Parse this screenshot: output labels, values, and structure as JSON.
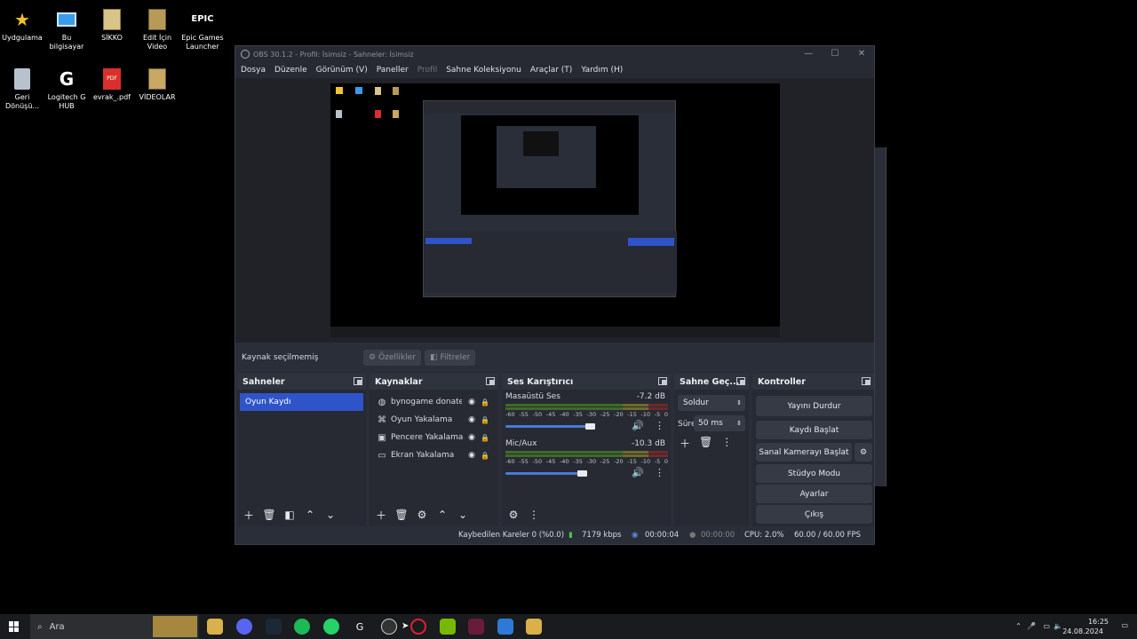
{
  "desktop": {
    "icons": [
      {
        "label": "Uydgulama"
      },
      {
        "label": "Bu bilgisayar"
      },
      {
        "label": "SİKKO"
      },
      {
        "label": "Edit İçin Video"
      },
      {
        "label": "Epic Games Launcher"
      },
      {
        "label": "Geri Dönüşü..."
      },
      {
        "label": "Logitech G HUB"
      },
      {
        "label": "evrak_.pdf"
      },
      {
        "label": "VİDEOLAR"
      }
    ]
  },
  "obs": {
    "title": "OBS 30.1.2 - Profil: İsimsiz - Sahneler: İsimsiz",
    "menu": [
      "Dosya",
      "Düzenle",
      "Görünüm (V)",
      "Paneller",
      "Profil",
      "Sahne Koleksiyonu",
      "Araçlar (T)",
      "Yardım (H)"
    ],
    "source_bar": {
      "status": "Kaynak seçilmemiş",
      "properties": "Özellikler",
      "filters": "Filtreler"
    },
    "scenes": {
      "title": "Sahneler",
      "items": [
        "Oyun Kaydı"
      ]
    },
    "sources": {
      "title": "Kaynaklar",
      "items": [
        "bynogame donate s",
        "Oyun Yakalama",
        "Pencere Yakalama",
        "Ekran Yakalama"
      ]
    },
    "mixer": {
      "title": "Ses Karıştırıcı",
      "channels": [
        {
          "name": "Masaüstü Ses",
          "db": "-7.2 dB",
          "level": 0.55
        },
        {
          "name": "Mic/Aux",
          "db": "-10.3 dB",
          "level": 0.5
        }
      ],
      "scale": [
        "-60",
        "-55",
        "-50",
        "-45",
        "-40",
        "-35",
        "-30",
        "-25",
        "-20",
        "-15",
        "-10",
        "-5",
        "0"
      ]
    },
    "transitions": {
      "title": "Sahne Geç...",
      "selected": "Soldur",
      "duration_label": "Süre",
      "duration_value": "50 ms"
    },
    "controls": {
      "title": "Kontroller",
      "stop_stream": "Yayını Durdur",
      "start_recording": "Kaydı Başlat",
      "virtual_camera": "Sanal Kamerayı Başlat",
      "studio_mode": "Stüdyo Modu",
      "settings": "Ayarlar",
      "exit": "Çıkış"
    },
    "status": {
      "dropped": "Kaybedilen Kareler 0 (%0.0)",
      "bitrate": "7179 kbps",
      "stream_time": "00:00:04",
      "rec_time": "00:00:00",
      "cpu": "CPU: 2.0%",
      "fps": "60.00 / 60.00 FPS"
    }
  },
  "taskbar": {
    "search_placeholder": "Ara",
    "time": "16:25",
    "date": "24.08.2024"
  },
  "colors": {
    "accent": "#2f54c9",
    "panel": "#272a33",
    "window": "#2a2e38"
  }
}
